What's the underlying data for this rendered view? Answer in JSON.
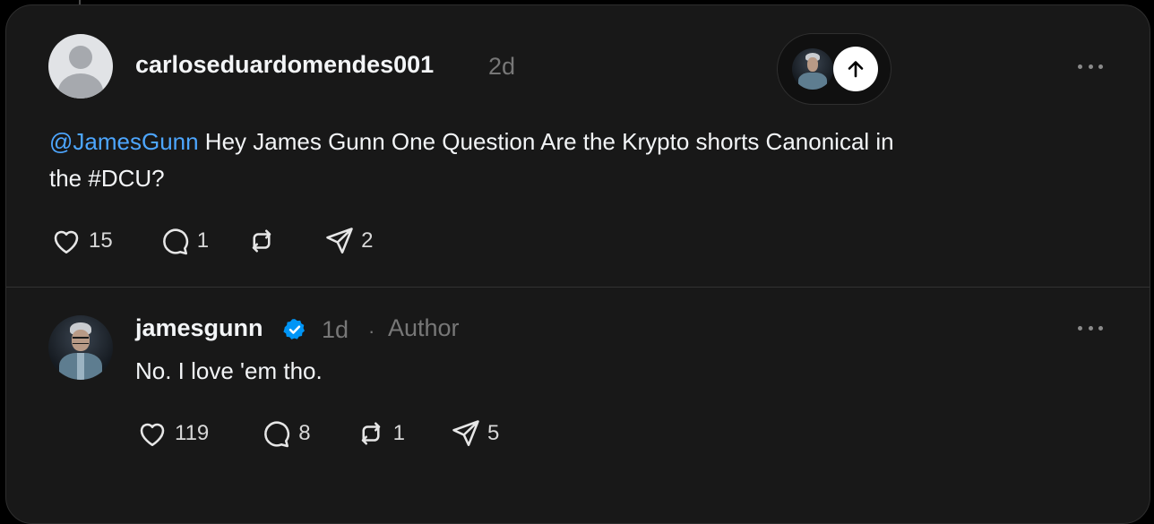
{
  "post": {
    "username": "carloseduardomendes001",
    "time": "2d",
    "mention": "@JamesGunn",
    "text_line1": " Hey James Gunn One Question Are the Krypto shorts Canonical in",
    "text_line2": "the #DCU?",
    "likes": "15",
    "replies": "1",
    "reposts": "",
    "shares": "2"
  },
  "reply": {
    "username": "jamesgunn",
    "time": "1d",
    "separator": "·",
    "author_label": "Author",
    "text": "No. I love 'em tho.",
    "likes": "119",
    "replies": "8",
    "reposts": "1",
    "shares": "5"
  },
  "icons": {
    "like": "heart-icon",
    "reply": "comment-icon",
    "repost": "repost-icon",
    "share": "share-icon",
    "more": "more-icon",
    "verified": "verified-badge-icon",
    "scroll_up": "arrow-up-icon"
  },
  "colors": {
    "background": "#181818",
    "mention": "#4da6ff",
    "verified": "#0095f6",
    "muted": "#777777"
  }
}
